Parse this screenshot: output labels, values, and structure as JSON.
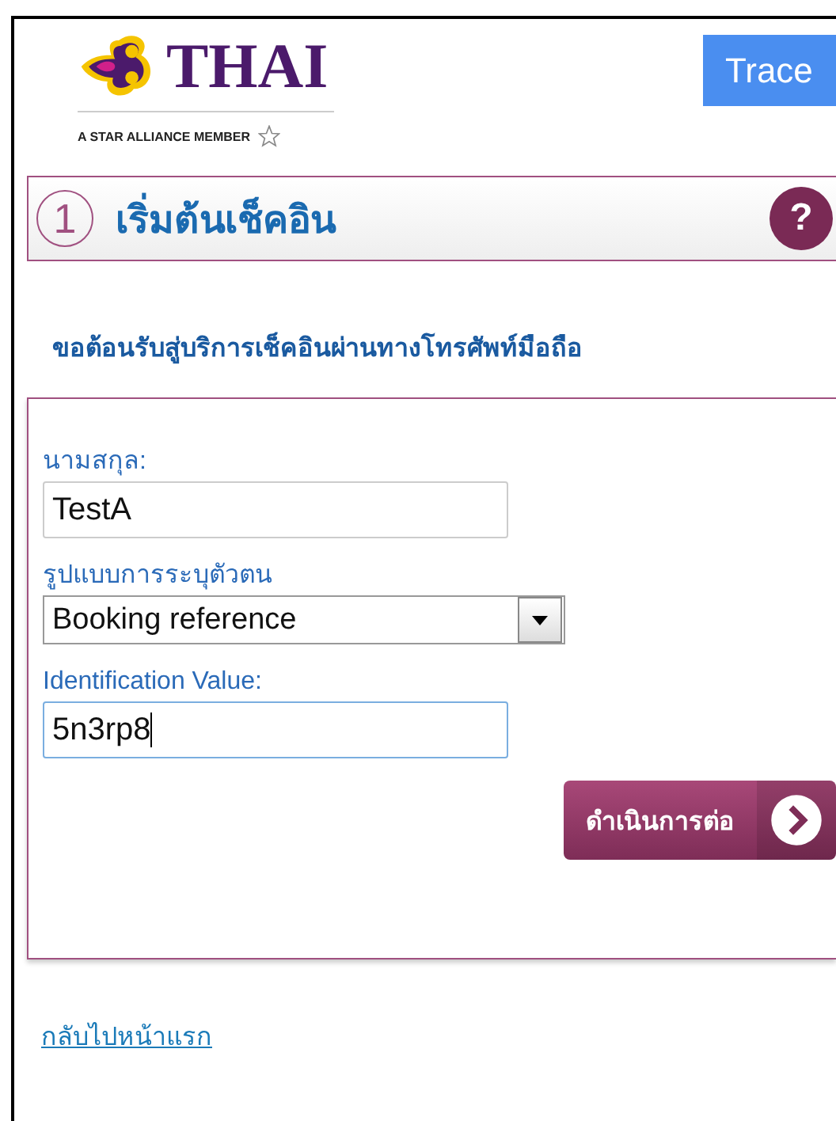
{
  "logo": {
    "name": "THAI",
    "tagline": "A STAR ALLIANCE MEMBER"
  },
  "trace_button": "Trace",
  "step": {
    "number": "1",
    "title": "เริ่มต้นเช็คอิน",
    "help": "?"
  },
  "welcome": "ขอต้อนรับสู่บริการเช็คอินผ่านทางโทรศัพท์มือถือ",
  "fields": [
    {
      "kind": "text",
      "label": "นามสกุล:",
      "value": "TestA",
      "focused": false
    },
    {
      "kind": "select",
      "label": "รูปแบบการระบุตัวตน",
      "value": "Booking reference",
      "focused": false
    },
    {
      "kind": "text",
      "label": "Identification Value:",
      "value": "5n3rp8",
      "focused": true
    }
  ],
  "continue_button": "ดำเนินการต่อ",
  "back_link": "กลับไปหน้าแรก"
}
